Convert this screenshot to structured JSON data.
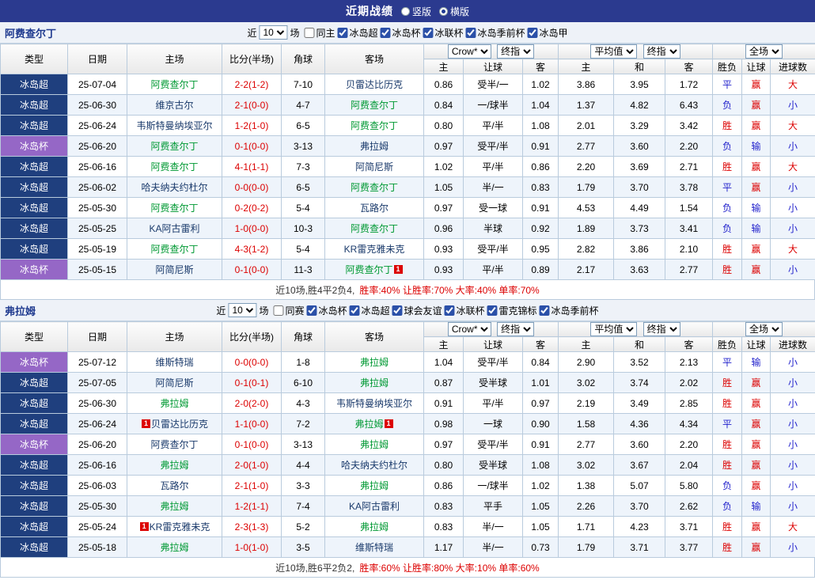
{
  "topbar": {
    "title": "近期战绩",
    "vertical_label": "竖版",
    "horizontal_label": "横版",
    "selected": "横版"
  },
  "labels": {
    "near": "近",
    "games": "场",
    "type": "类型",
    "date": "日期",
    "home": "主场",
    "score": "比分(半场)",
    "corner": "角球",
    "away": "客场",
    "bookmaker": "Crow*",
    "final_odds": "终指",
    "average": "平均值",
    "fulltime": "全场",
    "odds_home": "主",
    "odds_handicap": "让球",
    "odds_away": "客",
    "avg_home": "主",
    "avg_draw": "和",
    "avg_away": "客",
    "res_wdl": "胜负",
    "res_handicap": "让球",
    "res_goals": "进球数"
  },
  "colors": {
    "topbar_bg": "#2B3A8F",
    "league_super_bg": "#1F3F7E",
    "league_cup_bg": "#9567C6",
    "focal_team": "#009933",
    "win_red": "#DC0000",
    "lose_blue": "#2222CC"
  },
  "sections": [
    {
      "team": "阿费查尔丁",
      "filter": {
        "count": "10",
        "checks": [
          {
            "label": "同主",
            "checked": false
          },
          {
            "label": "冰岛超",
            "checked": true
          },
          {
            "label": "冰岛杯",
            "checked": true
          },
          {
            "label": "冰联杯",
            "checked": true
          },
          {
            "label": "冰岛季前杯",
            "checked": true
          },
          {
            "label": "冰岛甲",
            "checked": true
          }
        ]
      },
      "rows": [
        {
          "league": "冰岛超",
          "date": "25-07-04",
          "home": "阿费查尔丁",
          "home_focal": true,
          "home_card": false,
          "score": "2-2(1-2)",
          "corner": "7-10",
          "away": "贝雷达比历克",
          "away_focal": false,
          "away_card": false,
          "odds": [
            "0.86",
            "受半/一",
            "1.02"
          ],
          "avg": [
            "3.86",
            "3.95",
            "1.72"
          ],
          "results": [
            "平",
            "赢",
            "大"
          ]
        },
        {
          "league": "冰岛超",
          "date": "25-06-30",
          "home": "维京古尔",
          "home_focal": false,
          "home_card": false,
          "score": "2-1(0-0)",
          "corner": "4-7",
          "away": "阿费查尔丁",
          "away_focal": true,
          "away_card": false,
          "odds": [
            "0.84",
            "一/球半",
            "1.04"
          ],
          "avg": [
            "1.37",
            "4.82",
            "6.43"
          ],
          "results": [
            "负",
            "赢",
            "小"
          ]
        },
        {
          "league": "冰岛超",
          "date": "25-06-24",
          "home": "韦斯特曼纳埃亚尔",
          "home_focal": false,
          "home_card": false,
          "score": "1-2(1-0)",
          "corner": "6-5",
          "away": "阿费查尔丁",
          "away_focal": true,
          "away_card": false,
          "odds": [
            "0.80",
            "平/半",
            "1.08"
          ],
          "avg": [
            "2.01",
            "3.29",
            "3.42"
          ],
          "results": [
            "胜",
            "赢",
            "大"
          ]
        },
        {
          "league": "冰岛杯",
          "date": "25-06-20",
          "home": "阿费查尔丁",
          "home_focal": true,
          "home_card": false,
          "score": "0-1(0-0)",
          "corner": "3-13",
          "away": "弗拉姆",
          "away_focal": false,
          "away_card": false,
          "odds": [
            "0.97",
            "受平/半",
            "0.91"
          ],
          "avg": [
            "2.77",
            "3.60",
            "2.20"
          ],
          "results": [
            "负",
            "输",
            "小"
          ]
        },
        {
          "league": "冰岛超",
          "date": "25-06-16",
          "home": "阿费查尔丁",
          "home_focal": true,
          "home_card": false,
          "score": "4-1(1-1)",
          "corner": "7-3",
          "away": "阿简尼斯",
          "away_focal": false,
          "away_card": false,
          "odds": [
            "1.02",
            "平/半",
            "0.86"
          ],
          "avg": [
            "2.20",
            "3.69",
            "2.71"
          ],
          "results": [
            "胜",
            "赢",
            "大"
          ]
        },
        {
          "league": "冰岛超",
          "date": "25-06-02",
          "home": "哈夫纳夫约杜尔",
          "home_focal": false,
          "home_card": false,
          "score": "0-0(0-0)",
          "corner": "6-5",
          "away": "阿费查尔丁",
          "away_focal": true,
          "away_card": false,
          "odds": [
            "1.05",
            "半/一",
            "0.83"
          ],
          "avg": [
            "1.79",
            "3.70",
            "3.78"
          ],
          "results": [
            "平",
            "赢",
            "小"
          ]
        },
        {
          "league": "冰岛超",
          "date": "25-05-30",
          "home": "阿费查尔丁",
          "home_focal": true,
          "home_card": false,
          "score": "0-2(0-2)",
          "corner": "5-4",
          "away": "瓦路尔",
          "away_focal": false,
          "away_card": false,
          "odds": [
            "0.97",
            "受一球",
            "0.91"
          ],
          "avg": [
            "4.53",
            "4.49",
            "1.54"
          ],
          "results": [
            "负",
            "输",
            "小"
          ]
        },
        {
          "league": "冰岛超",
          "date": "25-05-25",
          "home": "KA阿古雷利",
          "home_focal": false,
          "home_card": false,
          "score": "1-0(0-0)",
          "corner": "10-3",
          "away": "阿费查尔丁",
          "away_focal": true,
          "away_card": false,
          "odds": [
            "0.96",
            "半球",
            "0.92"
          ],
          "avg": [
            "1.89",
            "3.73",
            "3.41"
          ],
          "results": [
            "负",
            "输",
            "小"
          ]
        },
        {
          "league": "冰岛超",
          "date": "25-05-19",
          "home": "阿费查尔丁",
          "home_focal": true,
          "home_card": false,
          "score": "4-3(1-2)",
          "corner": "5-4",
          "away": "KR雷克雅未克",
          "away_focal": false,
          "away_card": false,
          "odds": [
            "0.93",
            "受平/半",
            "0.95"
          ],
          "avg": [
            "2.82",
            "3.86",
            "2.10"
          ],
          "results": [
            "胜",
            "赢",
            "大"
          ]
        },
        {
          "league": "冰岛杯",
          "date": "25-05-15",
          "home": "阿简尼斯",
          "home_focal": false,
          "home_card": false,
          "score": "0-1(0-0)",
          "corner": "11-3",
          "away": "阿费查尔丁",
          "away_focal": true,
          "away_card": true,
          "odds": [
            "0.93",
            "平/半",
            "0.89"
          ],
          "avg": [
            "2.17",
            "3.63",
            "2.77"
          ],
          "results": [
            "胜",
            "赢",
            "小"
          ]
        }
      ],
      "summary": {
        "record": "近10场,胜4平2负4,",
        "rates": "胜率:40% 让胜率:70% 大率:40% 单率:70%"
      }
    },
    {
      "team": "弗拉姆",
      "filter": {
        "count": "10",
        "checks": [
          {
            "label": "同赛",
            "checked": false
          },
          {
            "label": "冰岛杯",
            "checked": true
          },
          {
            "label": "冰岛超",
            "checked": true
          },
          {
            "label": "球会友谊",
            "checked": true
          },
          {
            "label": "冰联杯",
            "checked": true
          },
          {
            "label": "雷克锦标",
            "checked": true
          },
          {
            "label": "冰岛季前杯",
            "checked": true
          }
        ]
      },
      "rows": [
        {
          "league": "冰岛杯",
          "date": "25-07-12",
          "home": "维斯特瑞",
          "home_focal": false,
          "home_card": false,
          "score": "0-0(0-0)",
          "corner": "1-8",
          "away": "弗拉姆",
          "away_focal": true,
          "away_card": false,
          "odds": [
            "1.04",
            "受平/半",
            "0.84"
          ],
          "avg": [
            "2.90",
            "3.52",
            "2.13"
          ],
          "results": [
            "平",
            "输",
            "小"
          ]
        },
        {
          "league": "冰岛超",
          "date": "25-07-05",
          "home": "阿简尼斯",
          "home_focal": false,
          "home_card": false,
          "score": "0-1(0-1)",
          "corner": "6-10",
          "away": "弗拉姆",
          "away_focal": true,
          "away_card": false,
          "odds": [
            "0.87",
            "受半球",
            "1.01"
          ],
          "avg": [
            "3.02",
            "3.74",
            "2.02"
          ],
          "results": [
            "胜",
            "赢",
            "小"
          ]
        },
        {
          "league": "冰岛超",
          "date": "25-06-30",
          "home": "弗拉姆",
          "home_focal": true,
          "home_card": false,
          "score": "2-0(2-0)",
          "corner": "4-3",
          "away": "韦斯特曼纳埃亚尔",
          "away_focal": false,
          "away_card": false,
          "odds": [
            "0.91",
            "平/半",
            "0.97"
          ],
          "avg": [
            "2.19",
            "3.49",
            "2.85"
          ],
          "results": [
            "胜",
            "赢",
            "小"
          ]
        },
        {
          "league": "冰岛超",
          "date": "25-06-24",
          "home": "贝雷达比历克",
          "home_focal": false,
          "home_card": true,
          "score": "1-1(0-0)",
          "corner": "7-2",
          "away": "弗拉姆",
          "away_focal": true,
          "away_card": true,
          "odds": [
            "0.98",
            "一球",
            "0.90"
          ],
          "avg": [
            "1.58",
            "4.36",
            "4.34"
          ],
          "results": [
            "平",
            "赢",
            "小"
          ]
        },
        {
          "league": "冰岛杯",
          "date": "25-06-20",
          "home": "阿费查尔丁",
          "home_focal": false,
          "home_card": false,
          "score": "0-1(0-0)",
          "corner": "3-13",
          "away": "弗拉姆",
          "away_focal": true,
          "away_card": false,
          "odds": [
            "0.97",
            "受平/半",
            "0.91"
          ],
          "avg": [
            "2.77",
            "3.60",
            "2.20"
          ],
          "results": [
            "胜",
            "赢",
            "小"
          ]
        },
        {
          "league": "冰岛超",
          "date": "25-06-16",
          "home": "弗拉姆",
          "home_focal": true,
          "home_card": false,
          "score": "2-0(1-0)",
          "corner": "4-4",
          "away": "哈夫纳夫约杜尔",
          "away_focal": false,
          "away_card": false,
          "odds": [
            "0.80",
            "受半球",
            "1.08"
          ],
          "avg": [
            "3.02",
            "3.67",
            "2.04"
          ],
          "results": [
            "胜",
            "赢",
            "小"
          ]
        },
        {
          "league": "冰岛超",
          "date": "25-06-03",
          "home": "瓦路尔",
          "home_focal": false,
          "home_card": false,
          "score": "2-1(1-0)",
          "corner": "3-3",
          "away": "弗拉姆",
          "away_focal": true,
          "away_card": false,
          "odds": [
            "0.86",
            "一/球半",
            "1.02"
          ],
          "avg": [
            "1.38",
            "5.07",
            "5.80"
          ],
          "results": [
            "负",
            "赢",
            "小"
          ]
        },
        {
          "league": "冰岛超",
          "date": "25-05-30",
          "home": "弗拉姆",
          "home_focal": true,
          "home_card": false,
          "score": "1-2(1-1)",
          "corner": "7-4",
          "away": "KA阿古雷利",
          "away_focal": false,
          "away_card": false,
          "odds": [
            "0.83",
            "平手",
            "1.05"
          ],
          "avg": [
            "2.26",
            "3.70",
            "2.62"
          ],
          "results": [
            "负",
            "输",
            "小"
          ]
        },
        {
          "league": "冰岛超",
          "date": "25-05-24",
          "home": "KR雷克雅未克",
          "home_focal": false,
          "home_card": true,
          "score": "2-3(1-3)",
          "corner": "5-2",
          "away": "弗拉姆",
          "away_focal": true,
          "away_card": false,
          "odds": [
            "0.83",
            "半/一",
            "1.05"
          ],
          "avg": [
            "1.71",
            "4.23",
            "3.71"
          ],
          "results": [
            "胜",
            "赢",
            "大"
          ]
        },
        {
          "league": "冰岛超",
          "date": "25-05-18",
          "home": "弗拉姆",
          "home_focal": true,
          "home_card": false,
          "score": "1-0(1-0)",
          "corner": "3-5",
          "away": "维斯特瑞",
          "away_focal": false,
          "away_card": false,
          "odds": [
            "1.17",
            "半/一",
            "0.73"
          ],
          "avg": [
            "1.79",
            "3.71",
            "3.77"
          ],
          "results": [
            "胜",
            "赢",
            "小"
          ]
        }
      ],
      "summary": {
        "record": "近10场,胜6平2负2,",
        "rates": "胜率:60% 让胜率:80% 大率:10% 单率:60%"
      }
    }
  ]
}
